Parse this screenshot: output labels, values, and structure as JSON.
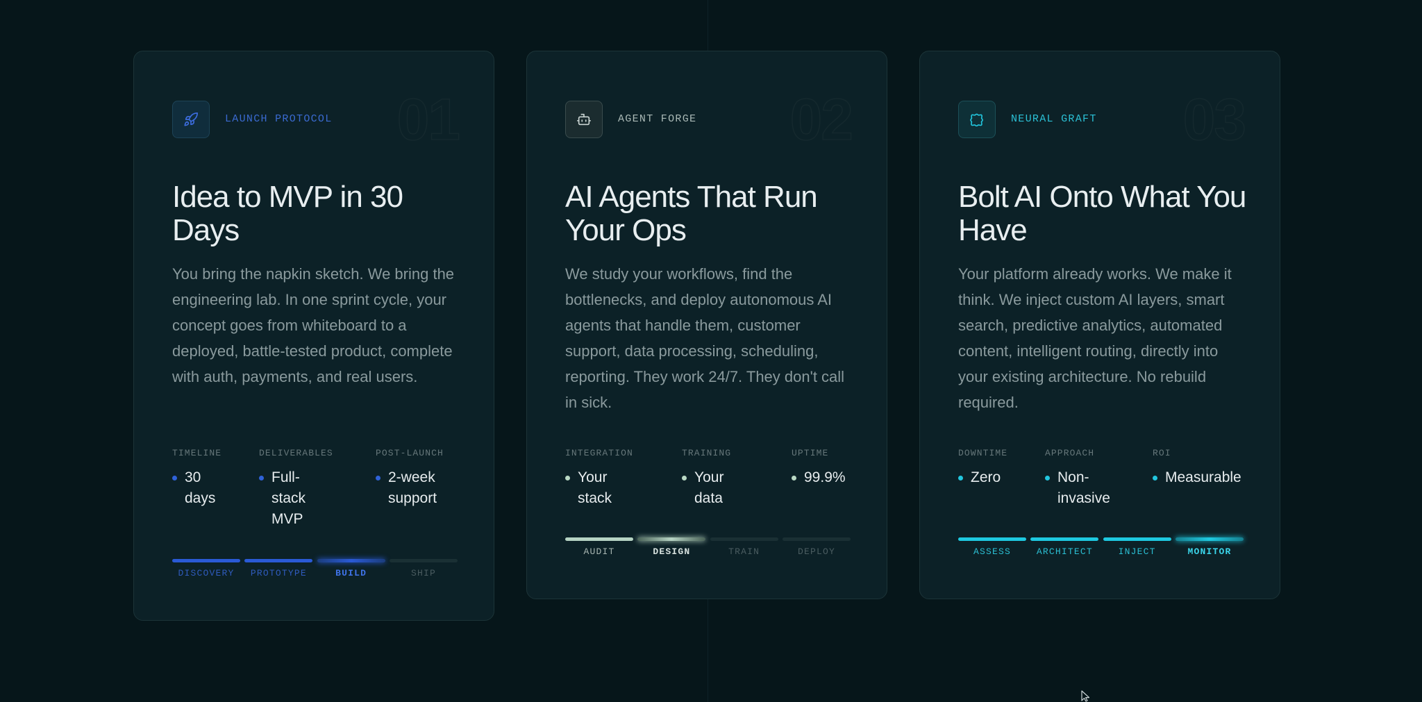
{
  "cards": [
    {
      "number": "01",
      "tag": "LAUNCH PROTOCOL",
      "icon": "rocket-icon",
      "title": "Idea to MVP in 30 Days",
      "description": "You bring the napkin sketch. We bring the engineering lab. In one sprint cycle, your concept goes from whiteboard to a deployed, battle-tested product, complete with auth, payments, and real users.",
      "stats": [
        {
          "label": "TIMELINE",
          "value": "30 days"
        },
        {
          "label": "DELIVERABLES",
          "value": "Full-stack MVP"
        },
        {
          "label": "POST-LAUNCH",
          "value": "2-week support"
        }
      ],
      "steps": [
        "DISCOVERY",
        "PROTOTYPE",
        "BUILD",
        "SHIP"
      ],
      "active_step": "BUILD",
      "accent": "#2a5ad6"
    },
    {
      "number": "02",
      "tag": "AGENT FORGE",
      "icon": "robot-icon",
      "title": "AI Agents That Run Your Ops",
      "description": "We study your workflows, find the bottlenecks, and deploy autonomous AI agents that handle them, customer support, data processing, scheduling, reporting. They work 24/7. They don't call in sick.",
      "stats": [
        {
          "label": "INTEGRATION",
          "value": "Your stack"
        },
        {
          "label": "TRAINING",
          "value": "Your data"
        },
        {
          "label": "UPTIME",
          "value": "99.9%"
        }
      ],
      "steps": [
        "AUDIT",
        "DESIGN",
        "TRAIN",
        "DEPLOY"
      ],
      "active_step": "DESIGN",
      "accent": "#b6d3c3"
    },
    {
      "number": "03",
      "tag": "NEURAL GRAFT",
      "icon": "puzzle-icon",
      "title": "Bolt AI Onto What You Have",
      "description": "Your platform already works. We make it think. We inject custom AI layers, smart search, predictive analytics, automated content, intelligent routing, directly into your existing architecture. No rebuild required.",
      "stats": [
        {
          "label": "DOWNTIME",
          "value": "Zero"
        },
        {
          "label": "APPROACH",
          "value": "Non-invasive"
        },
        {
          "label": "ROI",
          "value": "Measurable"
        }
      ],
      "steps": [
        "ASSESS",
        "ARCHITECT",
        "INJECT",
        "MONITOR"
      ],
      "active_step": "MONITOR",
      "accent": "#1ec9e0"
    }
  ]
}
